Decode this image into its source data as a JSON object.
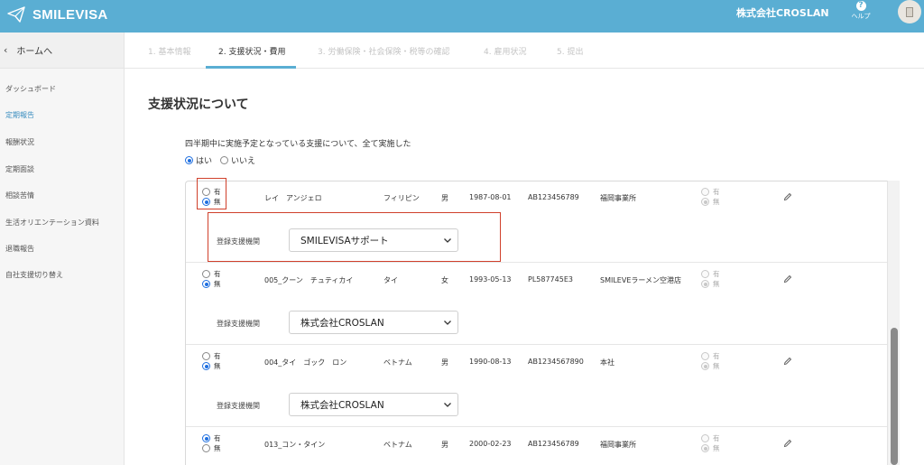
{
  "header": {
    "brand": "SMILEVISA",
    "company": "株式会社CROSLAN",
    "help_label": "ヘルプ"
  },
  "sidebar": {
    "home_label": "ホームへ",
    "items": [
      {
        "label": "ダッシュボード",
        "active": false
      },
      {
        "label": "定期報告",
        "active": true
      },
      {
        "label": "報酬状況",
        "active": false
      },
      {
        "label": "定期面談",
        "active": false
      },
      {
        "label": "相談苦情",
        "active": false
      },
      {
        "label": "生活オリエンテーション資料",
        "active": false
      },
      {
        "label": "退職報告",
        "active": false
      },
      {
        "label": "自社支援切り替え",
        "active": false
      }
    ]
  },
  "steps": [
    {
      "label": "1. 基本情報",
      "active": false
    },
    {
      "label": "2. 支援状況・費用",
      "active": true
    },
    {
      "label": "3. 労働保険・社会保険・税等の確認",
      "active": false
    },
    {
      "label": "4. 雇用状況",
      "active": false
    },
    {
      "label": "5. 提出",
      "active": false
    }
  ],
  "main": {
    "section_title": "支援状況について",
    "question": "四半期中に実施予定となっている支援について、全て実施した",
    "options": [
      {
        "label": "はい",
        "selected": true
      },
      {
        "label": "いいえ",
        "selected": false
      }
    ]
  },
  "table": {
    "yes_label": "有",
    "no_label": "無",
    "org_label": "登録支援機関",
    "rows": [
      {
        "selection": "無",
        "name": "レイ　アンジェロ",
        "nationality": "フィリピン",
        "gender": "男",
        "birthdate": "1987-08-01",
        "id": "AB123456789",
        "office": "福岡事業所",
        "status": "無",
        "org": "SMILEVISAサポート"
      },
      {
        "selection": "無",
        "name": "005_クーン　チュティカイ",
        "nationality": "タイ",
        "gender": "女",
        "birthdate": "1993-05-13",
        "id": "PL587745E3",
        "office": "SMILEVEラーメン空港店",
        "status": "無",
        "org": "株式会社CROSLAN"
      },
      {
        "selection": "無",
        "name": "004_タイ　ゴック　ロン",
        "nationality": "ベトナム",
        "gender": "男",
        "birthdate": "1990-08-13",
        "id": "AB1234567890",
        "office": "本社",
        "status": "無",
        "org": "株式会社CROSLAN"
      },
      {
        "selection": "有",
        "name": "013_コン・タイン",
        "nationality": "ベトナム",
        "gender": "男",
        "birthdate": "2000-02-23",
        "id": "AB123456789",
        "office": "福岡事業所",
        "status": "無",
        "org": ""
      }
    ]
  },
  "colors": {
    "header": "#5aaed3",
    "accent": "#3d8fc0",
    "highlight": "#d0402b",
    "radio": "#1f6fe0"
  }
}
